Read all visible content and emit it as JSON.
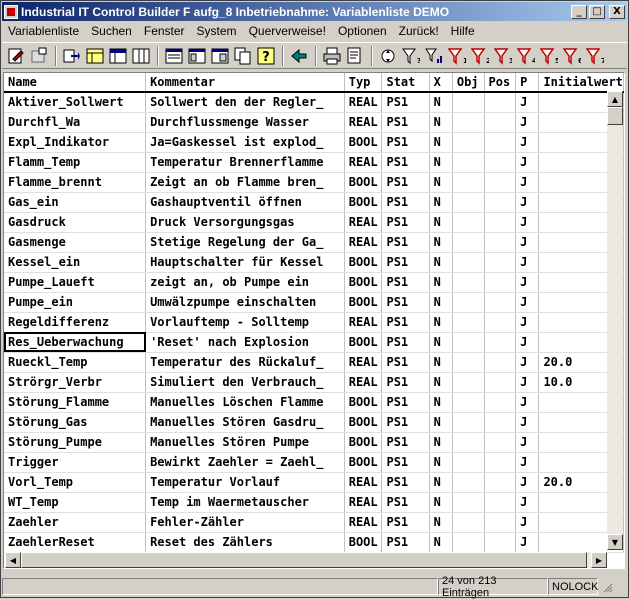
{
  "window": {
    "title": "Industrial IT Control Builder F aufg_8  Inbetriebnahme: Variablenliste  DEMO",
    "minimize": "_",
    "maximize": "□",
    "close": "X"
  },
  "menu": [
    "Variablenliste",
    "Suchen",
    "Fenster",
    "System",
    "Querverweise!",
    "Optionen",
    "Zurück!",
    "Hilfe"
  ],
  "toolbar": {
    "filters": [
      "Y",
      "Y1",
      "Y2",
      "Y3",
      "Y4",
      "Y5",
      "Y6",
      "Y7"
    ]
  },
  "table": {
    "columns": [
      "Name",
      "Kommentar",
      "Typ",
      "Stat",
      "X",
      "Obj",
      "Pos",
      "P",
      "Initialwert"
    ],
    "rows": [
      [
        "Aktiver_Sollwert",
        "Sollwert den der Regler_",
        "REAL",
        "PS1",
        "N",
        "",
        "",
        "J",
        ""
      ],
      [
        "Durchfl_Wa",
        "Durchflussmenge Wasser",
        "REAL",
        "PS1",
        "N",
        "",
        "",
        "J",
        ""
      ],
      [
        "Expl_Indikator",
        "Ja=Gaskessel ist explod_",
        "BOOL",
        "PS1",
        "N",
        "",
        "",
        "J",
        ""
      ],
      [
        "Flamm_Temp",
        "Temperatur Brennerflamme",
        "REAL",
        "PS1",
        "N",
        "",
        "",
        "J",
        ""
      ],
      [
        "Flamme_brennt",
        "Zeigt an ob Flamme bren_",
        "BOOL",
        "PS1",
        "N",
        "",
        "",
        "J",
        ""
      ],
      [
        "Gas_ein",
        "Gashauptventil öffnen",
        "BOOL",
        "PS1",
        "N",
        "",
        "",
        "J",
        ""
      ],
      [
        "Gasdruck",
        "Druck Versorgungsgas",
        "REAL",
        "PS1",
        "N",
        "",
        "",
        "J",
        ""
      ],
      [
        "Gasmenge",
        "Stetige Regelung der Ga_",
        "REAL",
        "PS1",
        "N",
        "",
        "",
        "J",
        ""
      ],
      [
        "Kessel_ein",
        "Hauptschalter für Kessel",
        "BOOL",
        "PS1",
        "N",
        "",
        "",
        "J",
        ""
      ],
      [
        "Pumpe_Laueft",
        "zeigt an, ob Pumpe ein",
        "BOOL",
        "PS1",
        "N",
        "",
        "",
        "J",
        ""
      ],
      [
        "Pumpe_ein",
        "Umwälzpumpe einschalten",
        "BOOL",
        "PS1",
        "N",
        "",
        "",
        "J",
        ""
      ],
      [
        "Regeldifferenz",
        "Vorlauftemp - Solltemp",
        "REAL",
        "PS1",
        "N",
        "",
        "",
        "J",
        ""
      ],
      [
        "Res_Ueberwachung",
        "'Reset' nach Explosion",
        "BOOL",
        "PS1",
        "N",
        "",
        "",
        "J",
        ""
      ],
      [
        "Rueckl_Temp",
        "Temperatur des Rückaluf_",
        "REAL",
        "PS1",
        "N",
        "",
        "",
        "J",
        "20.0"
      ],
      [
        "Strörgr_Verbr",
        "Simuliert den Verbrauch_",
        "REAL",
        "PS1",
        "N",
        "",
        "",
        "J",
        "10.0"
      ],
      [
        "Störung_Flamme",
        "Manuelles Löschen Flamme",
        "BOOL",
        "PS1",
        "N",
        "",
        "",
        "J",
        ""
      ],
      [
        "Störung_Gas",
        "Manuelles Stören Gasdru_",
        "BOOL",
        "PS1",
        "N",
        "",
        "",
        "J",
        ""
      ],
      [
        "Störung_Pumpe",
        "Manuelles Stören Pumpe",
        "BOOL",
        "PS1",
        "N",
        "",
        "",
        "J",
        ""
      ],
      [
        "Trigger",
        "Bewirkt Zaehler = Zaehl_",
        "BOOL",
        "PS1",
        "N",
        "",
        "",
        "J",
        ""
      ],
      [
        "Vorl_Temp",
        "Temperatur Vorlauf",
        "REAL",
        "PS1",
        "N",
        "",
        "",
        "J",
        "20.0"
      ],
      [
        "WT_Temp",
        "Temp im Waermetauscher",
        "REAL",
        "PS1",
        "N",
        "",
        "",
        "J",
        ""
      ],
      [
        "Zaehler",
        "Fehler-Zähler",
        "REAL",
        "PS1",
        "N",
        "",
        "",
        "J",
        ""
      ],
      [
        "ZaehlerReset",
        "Reset des Zählers",
        "BOOL",
        "PS1",
        "N",
        "",
        "",
        "J",
        ""
      ]
    ],
    "selected_row": 12
  },
  "status": {
    "count": "24 von 213 Einträgen",
    "lock": "NOLOCK"
  }
}
